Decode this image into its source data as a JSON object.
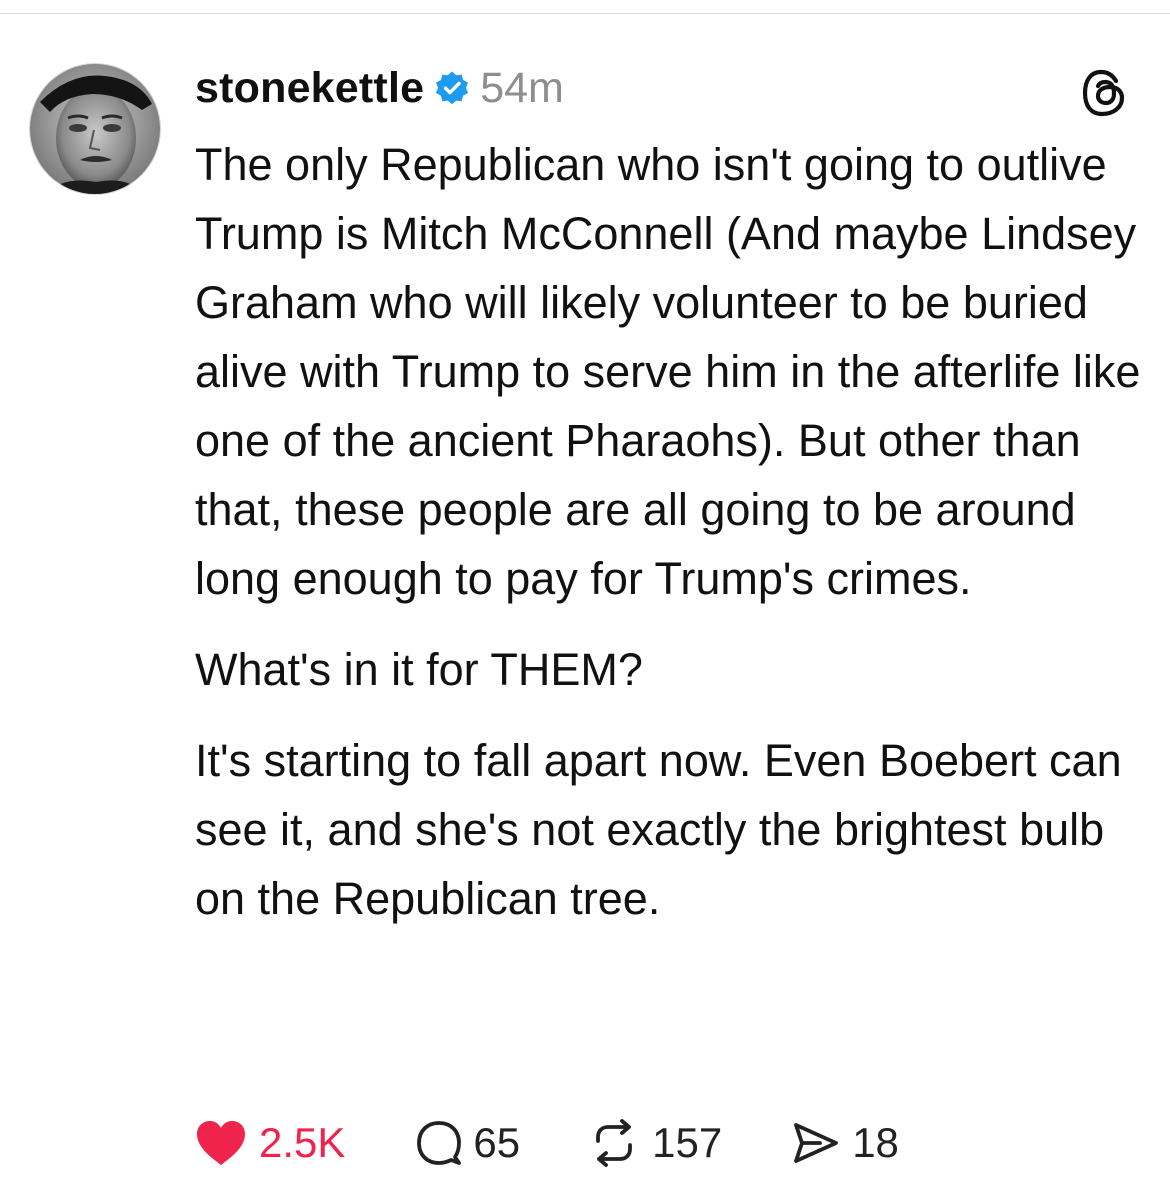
{
  "post": {
    "author": {
      "username": "stonekettle",
      "verified": true,
      "avatar_icon": "avatar-photo"
    },
    "timestamp": "54m",
    "app_icon": "threads-logo-icon",
    "paragraphs": [
      "The only Republican who isn't going to outlive Trump is Mitch McConnell (And maybe Lindsey Graham who will likely volunteer to be buried alive with Trump to serve him in the afterlife like one of the ancient Pharaohs). But other than that, these people are all going to be around long enough to pay for Trump's crimes.",
      "What's in it for THEM?",
      "It's starting to fall apart now. Even Boebert can see it, and she's not exactly the brightest bulb on the Republican tree."
    ],
    "stats": {
      "likes": "2.5K",
      "replies": "65",
      "reposts": "157",
      "shares": "18"
    }
  },
  "colors": {
    "like": "#f0234d",
    "verified": "#1d9bf0",
    "muted": "#8e8e8e",
    "text": "#111111"
  }
}
